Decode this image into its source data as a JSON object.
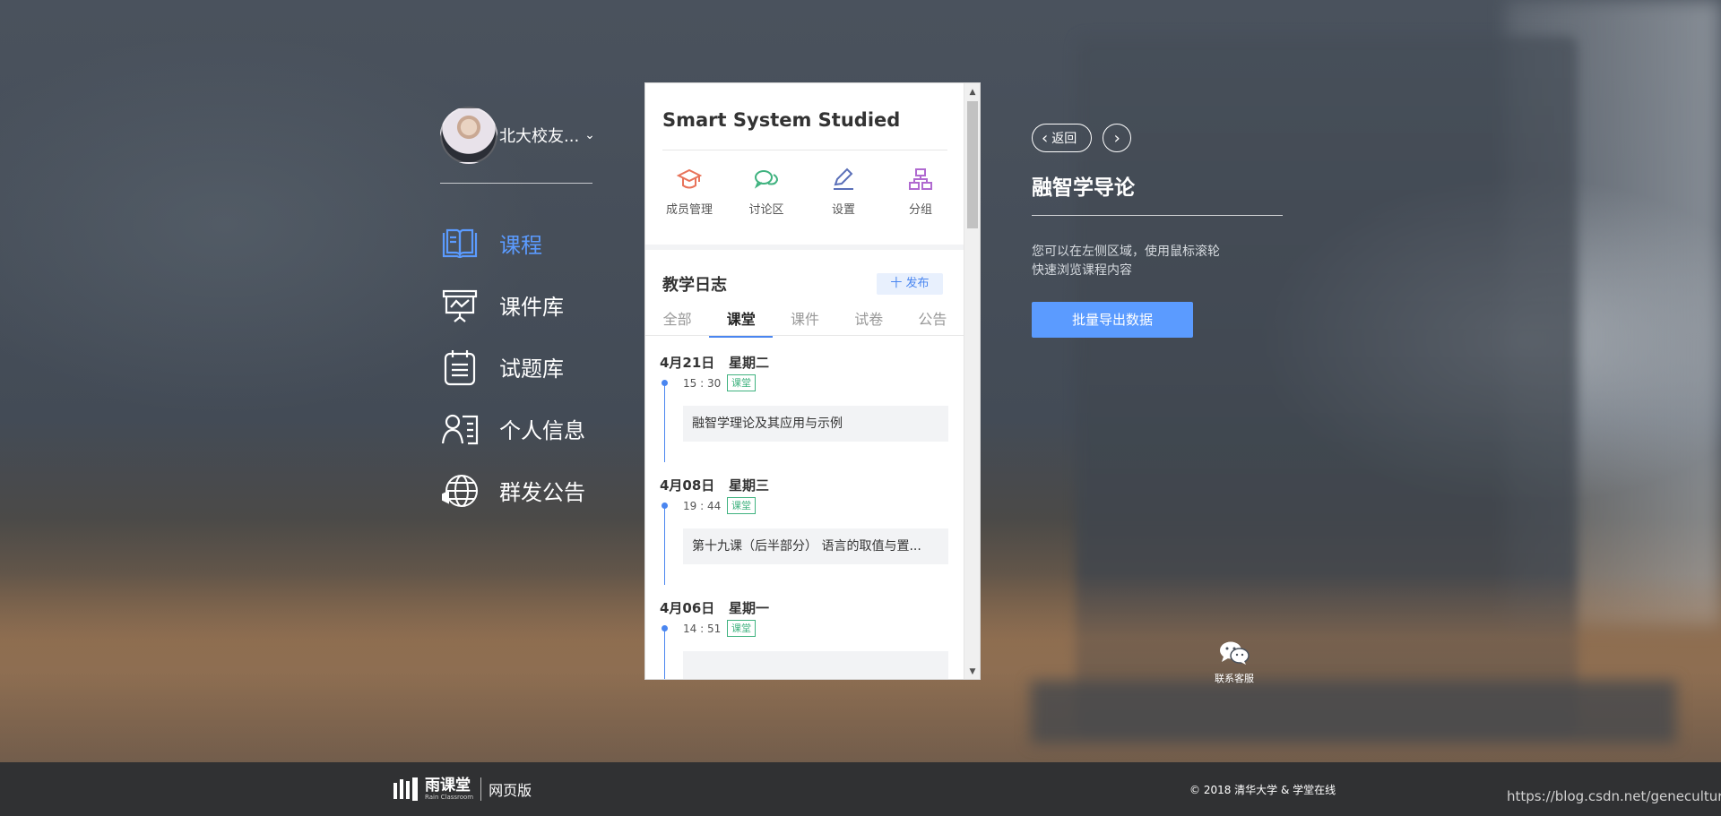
{
  "user": {
    "name": "北大校友...",
    "chevron": "chevron-down-icon"
  },
  "nav": {
    "items": [
      {
        "label": "课程",
        "icon": "book-icon",
        "active": true
      },
      {
        "label": "课件库",
        "icon": "presentation-icon",
        "active": false
      },
      {
        "label": "试题库",
        "icon": "clipboard-icon",
        "active": false
      },
      {
        "label": "个人信息",
        "icon": "user-card-icon",
        "active": false
      },
      {
        "label": "群发公告",
        "icon": "globe-icon",
        "active": false
      }
    ]
  },
  "panel": {
    "course_title": "Smart System Studied",
    "tools": [
      {
        "label": "成员管理",
        "icon": "graduation-cap-icon",
        "color": "#e8735a"
      },
      {
        "label": "讨论区",
        "icon": "chat-icon",
        "color": "#3fb27f"
      },
      {
        "label": "设置",
        "icon": "edit-icon",
        "color": "#5a6fb8"
      },
      {
        "label": "分组",
        "icon": "group-tree-icon",
        "color": "#b06ad0"
      }
    ],
    "log_title": "教学日志",
    "publish_label": "十 发布",
    "tabs": [
      {
        "label": "全部",
        "active": false
      },
      {
        "label": "课堂",
        "active": true
      },
      {
        "label": "课件",
        "active": false
      },
      {
        "label": "试卷",
        "active": false
      },
      {
        "label": "公告",
        "active": false
      }
    ],
    "entries": [
      {
        "date": "4月21日   星期二",
        "time": "15 : 30",
        "tag": "课堂",
        "title": "融智学理论及其应用与示例"
      },
      {
        "date": "4月08日   星期三",
        "time": "19 : 44",
        "tag": "课堂",
        "title": "第十九课（后半部分） 语言的取值与置..."
      },
      {
        "date": "4月06日   星期一",
        "time": "14 : 51",
        "tag": "课堂",
        "title": ""
      }
    ]
  },
  "right": {
    "back_label": "返回",
    "course_name": "融智学导论",
    "hint_line1": "您可以在左侧区域，使用鼠标滚轮",
    "hint_line2": "快速浏览课程内容",
    "export_label": "批量导出数据"
  },
  "service": {
    "label": "联系客服",
    "icon": "wechat-icon"
  },
  "footer": {
    "brand_name": "雨课堂",
    "brand_sub": "Rain Classroom",
    "web_label": "网页版",
    "copyright": "© 2018 清华大学 & 学堂在线",
    "watermark": "https://blog.csdn.net/geneculture"
  },
  "colors": {
    "accent": "#5b9bff",
    "tag_green": "#3fb27f",
    "footer_bg": "#303133"
  }
}
